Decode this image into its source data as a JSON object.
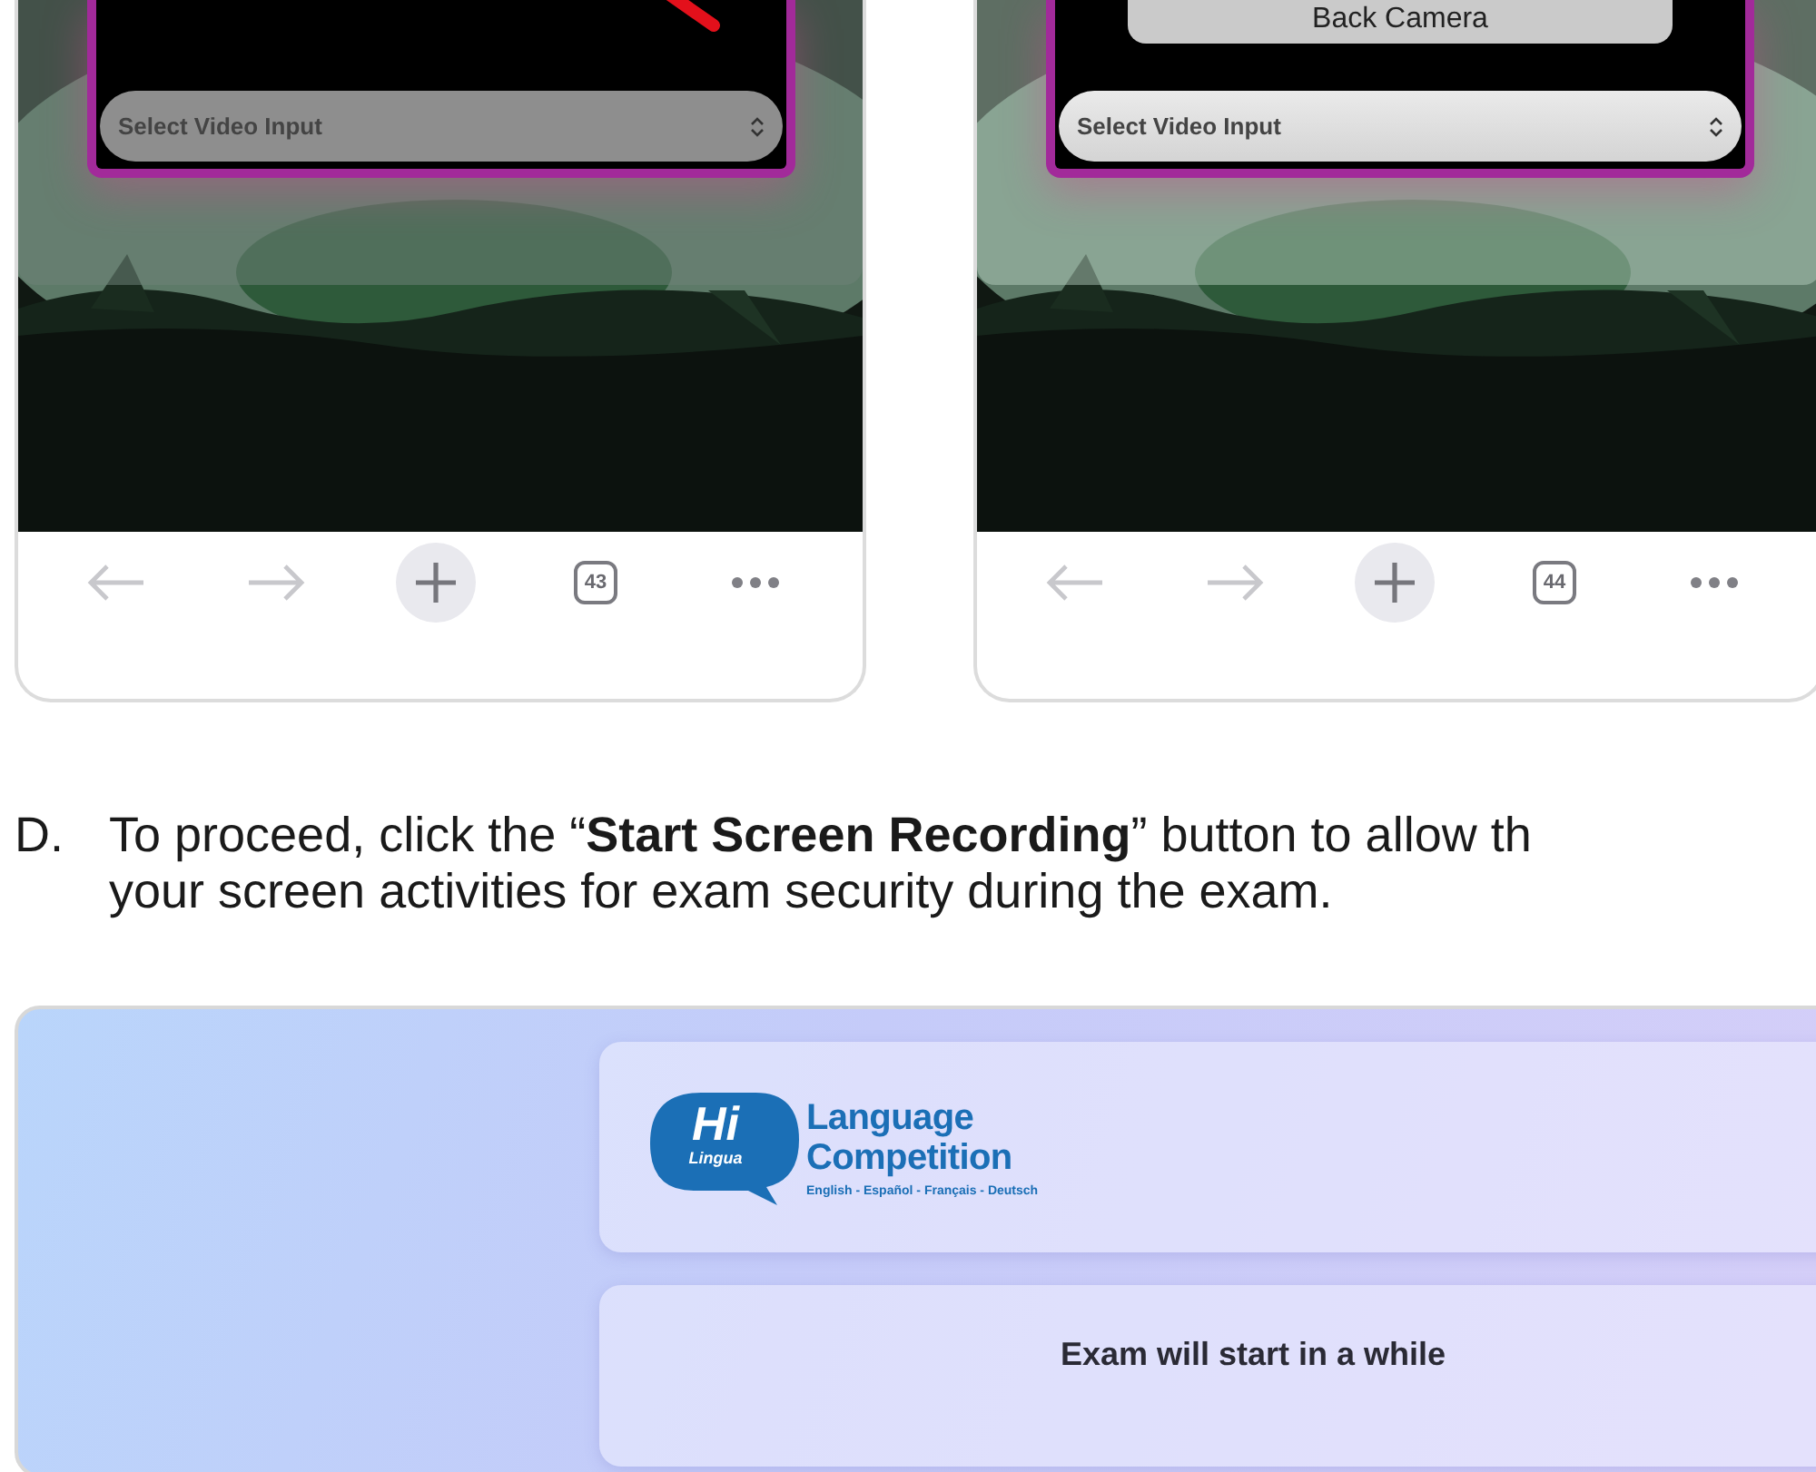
{
  "phones": [
    {
      "dimmed": true,
      "select": {
        "placeholder": "Select Video Input"
      },
      "camera_off": true,
      "tab_count": "43"
    },
    {
      "dimmed": false,
      "menu_items": [
        "Back Camera"
      ],
      "select": {
        "placeholder": "Select Video Input"
      },
      "camera_off": false,
      "tab_count": "44"
    }
  ],
  "instruction": {
    "marker": "D.",
    "lines": [
      "To proceed, click the “**Start Screen Recording**” button to allow th",
      "your screen activities for exam security during the exam."
    ]
  },
  "exam_screen": {
    "logo": {
      "mark": "Hi",
      "mark_sub": "Lingua",
      "title_lines": [
        "Language",
        "Competition"
      ],
      "tagline": "English - Español - Français - Deutsch"
    },
    "status": "Exam will start in a while"
  }
}
